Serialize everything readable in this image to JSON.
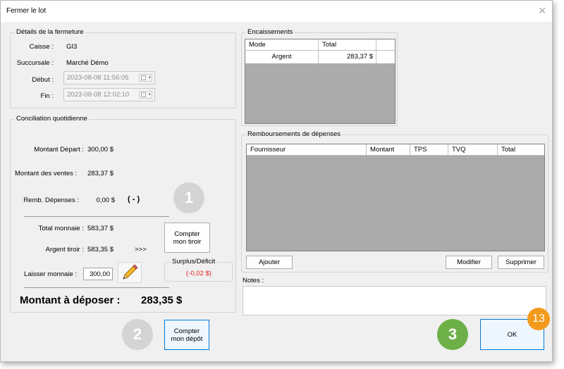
{
  "window": {
    "title": "Fermer le lot",
    "close_symbol": "✕"
  },
  "details": {
    "title": "Détails de la fermeture",
    "caisse_label": "Caisse :",
    "caisse_value": "GI3",
    "succursale_label": "Succursale :",
    "succursale_value": "Marché Démo",
    "debut_label": "Début :",
    "debut_value": "2023-08-08 11:56:05",
    "fin_label": "Fin :",
    "fin_value": "2023-08-08 12:02:10"
  },
  "conciliation": {
    "title": "Conciliation quotidienne",
    "montant_depart_label": "Montant Départ :",
    "montant_depart_value": "300,00 $",
    "montant_ventes_label": "Montant des ventes :",
    "montant_ventes_value": "283,37 $",
    "remb_depenses_label": "Remb. Dépenses :",
    "remb_depenses_value": "0,00 $",
    "remb_sign": "( - )",
    "total_monnaie_label": "Total monnaie :",
    "total_monnaie_value": "583,37 $",
    "argent_tiroir_label": "Argent tiroir :",
    "argent_tiroir_value": "583,35 $",
    "arrows": ">>>",
    "laisser_monnaie_label": "Laisser monnaie :",
    "laisser_monnaie_value": "300,00",
    "surplus_title": "Surplus/Déficit",
    "surplus_value": "(-0,02 $)",
    "montant_deposer_label": "Montant à déposer :",
    "montant_deposer_value": "283,35 $",
    "compter_tiroir_label": "Compter mon tiroir",
    "compter_depot_label": "Compter mon dépôt"
  },
  "steps": {
    "step1": "1",
    "step2": "2",
    "step3": "3",
    "badge": "13"
  },
  "encaissements": {
    "title": "Encaissements",
    "columns": [
      "Mode",
      "Total"
    ],
    "rows": [
      {
        "mode": "Argent",
        "total": "283,37 $"
      }
    ]
  },
  "remboursements": {
    "title": "Remboursements de dépenses",
    "columns": [
      "Fournisseur",
      "Montant",
      "TPS",
      "TVQ",
      "Total"
    ],
    "ajouter_label": "Ajouter",
    "modifier_label": "Modifier",
    "supprimer_label": "Supprimer"
  },
  "notes": {
    "label": "Notes :",
    "value": ""
  },
  "ok_label": "OK",
  "colors": {
    "accent": "#0078d7",
    "surplus_red": "#e02020",
    "step_green": "#6eb048",
    "step_gray": "#d4d4d4",
    "badge_orange": "#f39a1c"
  },
  "icons": {
    "edit": "pencil-icon"
  }
}
